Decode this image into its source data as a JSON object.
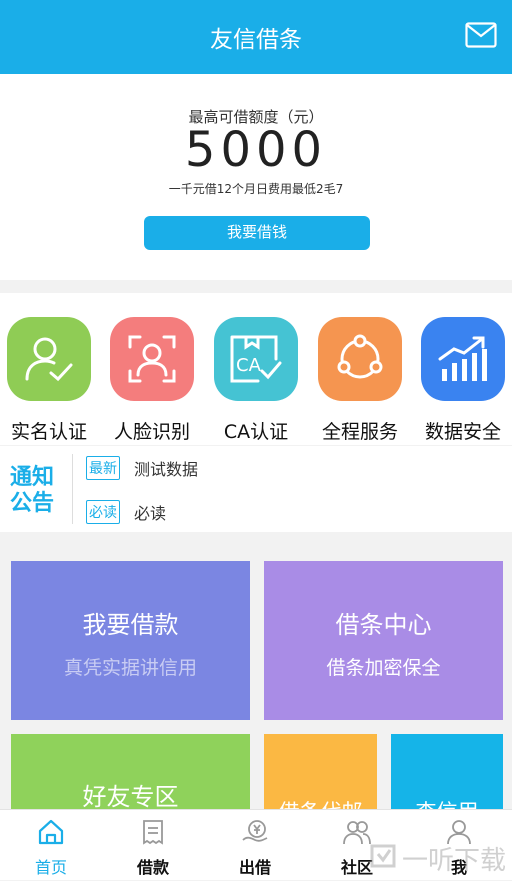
{
  "header": {
    "title": "友信借条",
    "mail_icon": "mail-icon"
  },
  "limit": {
    "label": "最高可借额度（元）",
    "amount": "5000",
    "note": "一千元借12个月日费用最低2毛7",
    "button": "我要借钱"
  },
  "features": [
    {
      "label": "实名认证",
      "icon": "verified-user-icon",
      "color": "#8fcc55"
    },
    {
      "label": "人脸识别",
      "icon": "face-scan-icon",
      "color": "#f47d7d"
    },
    {
      "label": "CA认证",
      "icon": "ca-certificate-icon",
      "color": "#45c3d3"
    },
    {
      "label": "全程服务",
      "icon": "share-nodes-icon",
      "color": "#f59550"
    },
    {
      "label": "数据安全",
      "icon": "growth-chart-icon",
      "color": "#3a83f0"
    }
  ],
  "notice": {
    "logo_text": [
      "通知",
      "公告"
    ],
    "items": [
      {
        "tag": "最新",
        "text": "测试数据"
      },
      {
        "tag": "必读",
        "text": "必读"
      }
    ]
  },
  "tiles": [
    {
      "title": "我要借款",
      "subtitle": "真凭实据讲信用",
      "color": "#7b86e2"
    },
    {
      "title": "借条中心",
      "subtitle": "借条加密保全",
      "color": "#a98ce6"
    },
    {
      "title": "好友专区",
      "subtitle": "",
      "color": "#8fd25b"
    },
    {
      "title": "借条代邮",
      "subtitle": "",
      "color": "#fbb843"
    },
    {
      "title": "查信用",
      "subtitle": "",
      "color": "#15b4e8"
    }
  ],
  "tabs": [
    {
      "label": "首页",
      "icon": "home-icon",
      "active": true
    },
    {
      "label": "借款",
      "icon": "receipt-icon",
      "active": false
    },
    {
      "label": "出借",
      "icon": "yen-hand-icon",
      "active": false
    },
    {
      "label": "社区",
      "icon": "community-icon",
      "active": false
    },
    {
      "label": "我",
      "icon": "user-icon",
      "active": false
    }
  ],
  "watermark": "一听下载",
  "colors": {
    "accent": "#1aaee8"
  }
}
